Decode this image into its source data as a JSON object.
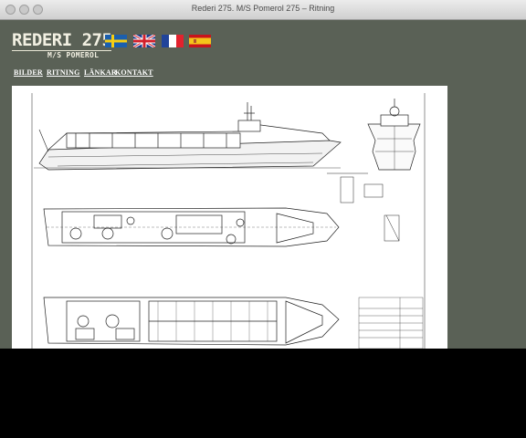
{
  "window": {
    "title": "Rederi 275. M/S Pomerol 275 – Ritning"
  },
  "header": {
    "logo": "REDERI 275",
    "subtitle": "M/S POMEROL"
  },
  "flags": [
    {
      "icon": "flag-sweden-icon",
      "language": "Swedish"
    },
    {
      "icon": "flag-uk-icon",
      "language": "English"
    },
    {
      "icon": "flag-france-icon",
      "language": "French"
    },
    {
      "icon": "flag-spain-icon",
      "language": "Spanish"
    }
  ],
  "nav": {
    "bilder": "BILDER",
    "ritning": "RITNING",
    "lankar": "LÄNKAR",
    "kontakt": "KONTAKT"
  },
  "colors": {
    "background": "#5a6156",
    "text": "#f2f0e2"
  }
}
